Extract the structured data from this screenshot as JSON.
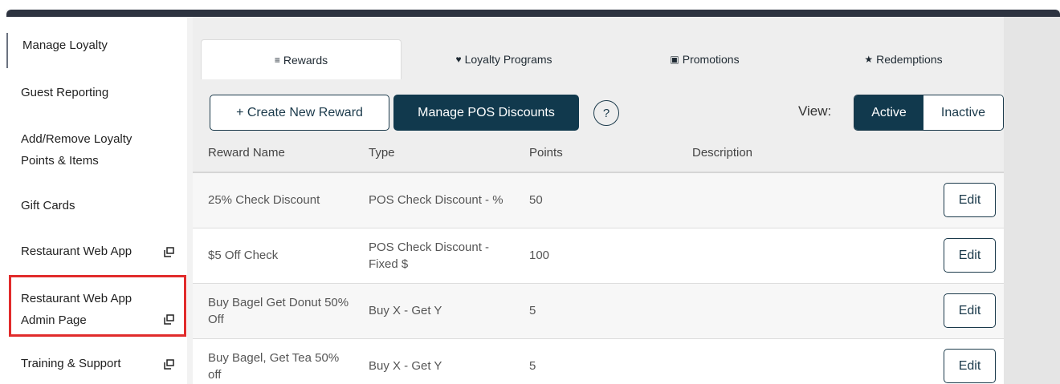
{
  "sidebar": {
    "items": [
      {
        "label": "Manage Loyalty"
      },
      {
        "label": "Guest Reporting"
      },
      {
        "label": "Add/Remove Loyalty",
        "label2": "Points & Items"
      },
      {
        "label": "Gift Cards"
      },
      {
        "label": "Restaurant Web App",
        "icon": "external-link-icon"
      },
      {
        "label": "Restaurant Web App",
        "label2": "Admin Page",
        "icon": "external-link-icon"
      },
      {
        "label": "Training & Support",
        "icon": "external-link-icon"
      }
    ]
  },
  "tabs": [
    {
      "label": "Rewards",
      "icon": "list-icon",
      "glyph": "≡"
    },
    {
      "label": "Loyalty Programs",
      "icon": "heart-icon",
      "glyph": "♥"
    },
    {
      "label": "Promotions",
      "icon": "gift-icon",
      "glyph": "▣"
    },
    {
      "label": "Redemptions",
      "icon": "star-icon",
      "glyph": "★"
    }
  ],
  "toolbar": {
    "create_label": "+ Create New Reward",
    "manage_label": "Manage POS Discounts",
    "help_label": "?",
    "view_label": "View:",
    "active_label": "Active",
    "inactive_label": "Inactive"
  },
  "table": {
    "headers": [
      "Reward Name",
      "Type",
      "Points",
      "Description"
    ],
    "rows": [
      {
        "name": "25% Check Discount",
        "type": "POS Check Discount - %",
        "points": "50",
        "description": "",
        "action": "Edit"
      },
      {
        "name": "$5 Off Check",
        "type": "POS Check Discount - Fixed $",
        "points": "100",
        "description": "",
        "action": "Edit"
      },
      {
        "name": "Buy Bagel Get Donut 50% Off",
        "type": "Buy X - Get Y",
        "points": "5",
        "description": "",
        "action": "Edit"
      },
      {
        "name": "Buy Bagel, Get Tea 50% off",
        "type": "Buy X - Get Y",
        "points": "5",
        "description": "",
        "action": "Edit"
      }
    ]
  },
  "colors": {
    "primary_dark": "#11394d",
    "highlight_red": "#e12b2b",
    "topbar": "#2d3340"
  }
}
